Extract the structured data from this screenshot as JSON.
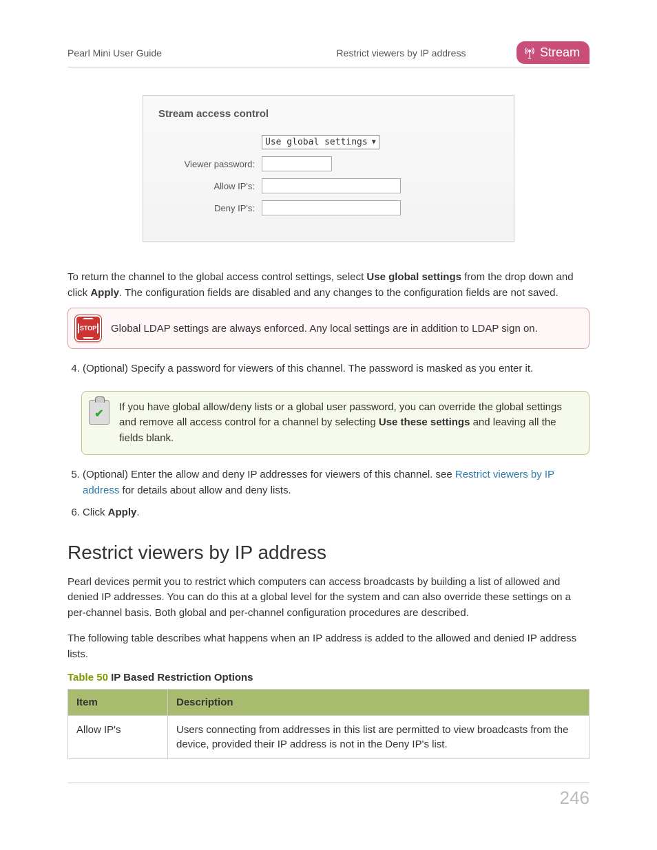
{
  "header": {
    "guide_title": "Pearl Mini User Guide",
    "section_name": "Restrict viewers by IP address",
    "badge": "Stream"
  },
  "screenshot": {
    "title": "Stream access control",
    "dropdown_value": "Use global settings",
    "labels": {
      "viewer_password": "Viewer password:",
      "allow_ips": "Allow IP's:",
      "deny_ips": "Deny IP's:"
    }
  },
  "para1": {
    "pre": "To return the channel to the global access control settings, select ",
    "bold1": "Use global settings",
    "mid": " from the drop down and click ",
    "bold2": "Apply",
    "post": ". The configuration fields are disabled and any changes to the configuration fields are not saved."
  },
  "stop_callout": "Global LDAP settings are always enforced. Any local settings are in addition to LDAP sign on.",
  "step4": "(Optional) Specify a password for viewers of this channel. The password is masked as you enter it.",
  "note_callout": {
    "pre": "If you have global allow/deny lists or a global user password, you can override the global settings and remove all access control for a channel by selecting ",
    "bold": "Use these settings",
    "post": " and leaving all the fields blank."
  },
  "step5": {
    "pre": "(Optional) Enter the allow and deny IP addresses for viewers of this channel. see ",
    "link": "Restrict viewers by IP address",
    "post": " for details about allow and deny lists."
  },
  "step6": {
    "pre": "Click ",
    "bold": "Apply",
    "post": "."
  },
  "section_title": "Restrict viewers by IP address",
  "para2": "Pearl devices permit you to restrict which computers can access broadcasts by building a list of allowed and denied IP addresses. You can do this at a global level for the system and can also override these settings on a per-channel basis. Both global and per-channel configuration procedures are described.",
  "para3": "The following table describes what happens when an IP address is added to the allowed and denied IP address lists.",
  "table": {
    "caption_num": "Table 50",
    "caption_text": " IP Based Restriction Options",
    "headers": {
      "item": "Item",
      "desc": "Description"
    },
    "rows": [
      {
        "item": "Allow IP's",
        "desc": "Users connecting from addresses in this list are permitted to view broadcasts from the device, provided their IP address is not in the Deny IP's list."
      }
    ]
  },
  "page_number": "246"
}
